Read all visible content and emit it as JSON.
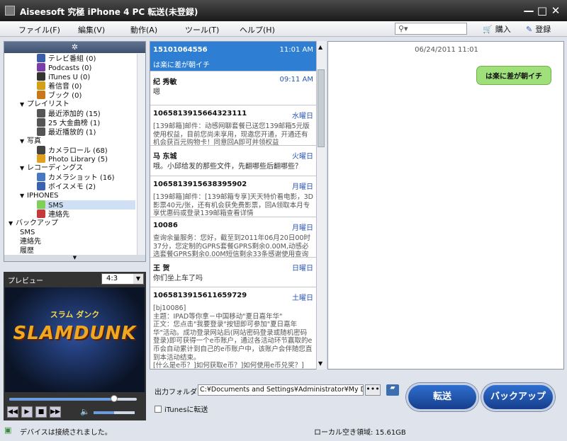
{
  "window": {
    "title": "Aiseesoft 究極 iPhone 4 PC 転送(未登録)"
  },
  "menu": [
    "ファイル(F)",
    "編集(V)",
    "動作(A)",
    "ツール(T)",
    "ヘルプ(H)"
  ],
  "toolbar": {
    "buy": "購入",
    "register": "登録"
  },
  "tree": [
    {
      "label": "テレビ番組 (0)",
      "level": 2,
      "icon": "tv-icon",
      "color": "#3a5fa8"
    },
    {
      "label": "Podcasts (0)",
      "level": 2,
      "icon": "podcast-icon",
      "color": "#7a3ea8"
    },
    {
      "label": "iTunes U (0)",
      "level": 2,
      "icon": "graduation-cap-icon",
      "color": "#333333"
    },
    {
      "label": "着信音 (0)",
      "level": 2,
      "icon": "bell-icon",
      "color": "#d4a017"
    },
    {
      "label": "ブック (0)",
      "level": 2,
      "icon": "book-icon",
      "color": "#c8781c"
    },
    {
      "label": "プレイリスト",
      "level": 1,
      "arrow": "▼"
    },
    {
      "label": "最近添加的 (15)",
      "level": 2,
      "icon": "gear-icon",
      "color": "#555555"
    },
    {
      "label": "25 大金曲榜 (1)",
      "level": 2,
      "icon": "gear-icon",
      "color": "#555555"
    },
    {
      "label": "最近播放的 (1)",
      "level": 2,
      "icon": "gear-icon",
      "color": "#555555"
    },
    {
      "label": "写真",
      "level": 1,
      "arrow": "▼"
    },
    {
      "label": "カメラロール (68)",
      "level": 2,
      "icon": "camera-icon",
      "color": "#444444"
    },
    {
      "label": "Photo Library (5)",
      "level": 2,
      "icon": "sunflower-icon",
      "color": "#e0a020"
    },
    {
      "label": "レコーディングス",
      "level": 1,
      "arrow": "▼"
    },
    {
      "label": "カメラショット (16)",
      "level": 2,
      "icon": "camera-shot-icon",
      "color": "#4a78c0"
    },
    {
      "label": "ボイスメモ (2)",
      "level": 2,
      "icon": "microphone-icon",
      "color": "#3a62b0"
    },
    {
      "label": "IPHONES",
      "level": 1,
      "arrow": "▼"
    },
    {
      "label": "SMS",
      "level": 2,
      "icon": "sms-icon",
      "color": "#7fcf5a",
      "selected": true
    },
    {
      "label": "連絡先",
      "level": 2,
      "icon": "contacts-icon",
      "color": "#c43a3a"
    },
    {
      "label": "バックアップ",
      "level": 0,
      "arrow": "▼"
    },
    {
      "label": "SMS",
      "level": 1
    },
    {
      "label": "連絡先",
      "level": 1
    },
    {
      "label": "履歴",
      "level": 1
    }
  ],
  "preview": {
    "label": "プレビュー",
    "ratio": "4:3",
    "logo": "SLAMDUNK",
    "logo_sub": "スラム ダンク",
    "progress": 0.82,
    "volume": 0.5
  },
  "messages": [
    {
      "name": "15101064556",
      "time": "11:01 AM",
      "body": "は楽に差が朝イチ",
      "selected": true
    },
    {
      "name": "纪 秀敏",
      "time": "09:11 AM",
      "body": "嗯",
      "single": true
    },
    {
      "name": "1065813915664323111",
      "time": "水曜日",
      "body": "[139邮箱]邮件：动感网聊套餐已送您139邮箱5元版使用权益，目前您尚未享用，现邀您开通，开通还有机会获百元购物卡！同意回A即可并领权益"
    },
    {
      "name": "马 东城",
      "time": "火曜日",
      "body": "哦。小邱给发的那些文件，先翻哪些后翻哪些？",
      "single": true
    },
    {
      "name": "1065813915638395902",
      "time": "月曜日",
      "body": "[139邮箱]邮件：[139邮箱专享]天天特价看电影，3D影票40元/张，还有机会获免费影票，回A领取本月专享优惠码或登录139邮箱查看详情"
    },
    {
      "name": "10086",
      "time": "月曜日",
      "body": "查询余量服务：您好，截至到2011年06月20日00时37分，您定制的GPRS套餐GPRS剩余0.00M,动感必选套餐GPRS剩余0.00M短信剩余33条感谢使用查询余量服务。"
    },
    {
      "name": "王 贺",
      "time": "日曜日",
      "body": "你们坐上车了吗",
      "single": true
    },
    {
      "name": "1065813915611659729",
      "time": "土曜日",
      "body": "[bj10086]\n主题：IPAD等你拿－中国移动\"夏日嘉年华\"\n正文：您点击\"我要登录\"按钮即可参加\"夏日嘉年华\"活动。成功登录网站后(网站密码登录或随机密码登录)即可获得一个e币账户，通过各活动环节赢取的e币会自动累计到自己的e币账户中，该账户会伴随您直到本活动结束。\n[什么是e币？]如何获取e币？]如何使用e币兑奖？]"
    }
  ],
  "conversation": {
    "date": "06/24/2011 11:01",
    "bubble": "は楽に差が朝イチ"
  },
  "bottom": {
    "output_label": "出力フォルダ:",
    "output_path": "C:¥Documents and Settings¥Administrator¥My Doc",
    "browse": "•••",
    "itunes_label": "iTunesに転送"
  },
  "buttons": {
    "transfer": "転送",
    "backup": "バックアップ"
  },
  "status": {
    "device": "デバイスは接続されました。",
    "space": "ローカル空き領域: 15.61GB"
  }
}
